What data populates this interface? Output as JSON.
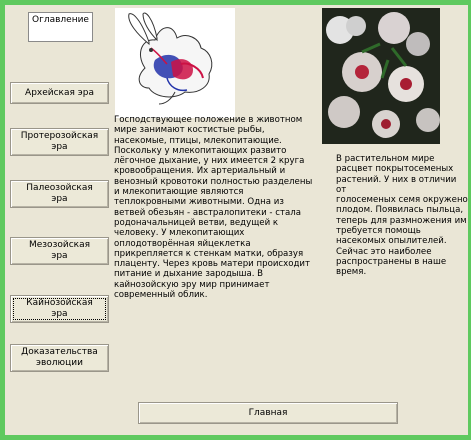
{
  "contents_label": "Оглавление",
  "nav": [
    {
      "label": "Архейская эра"
    },
    {
      "label": "Протерозойская\nэра"
    },
    {
      "label": "Палеозойская\nэра"
    },
    {
      "label": "Мезозойская\nэра"
    },
    {
      "label": "Кайнозойская\nэра"
    },
    {
      "label": "Доказательства\nэволюции"
    }
  ],
  "main_text": "Господствующее положение в животном\nмире  занимают костистые рыбы,\nнасекомые, птицы, млекопитающие.\nПоскольку у млекопитающих развито\nлёгочное дыхание, у них имеется 2 круга\nкровообращения. Их артериальный и\nвенозный кровотоки полностью разделены\nи млекопитающие являются\nтеплокровными животными.  Одна из\nветвей обезьян - австралопитеки - стала\nродоначальницей ветви, ведущей к\nчеловеку. У млекопитающих\nоплодотворённая яйцеклетка\nприкрепляется к стенкам матки, образуя\nплаценту. Через кровь матери происходит\nпитание и дыхание зародыша. В\nкайнозойскую эру  мир принимает\nсовременный облик.",
  "side_text": "В растительном мире\nрасцвет покрытосеменых\nрастений. У них в отличии от\nголосеменых семя окружено\nплодом. Появилась пыльца,\nтеперь для размножения им\nтребуется помощь\nнасекомых опылителей.\nСейчас это наиболее\nраспространены в наше\nвремя.",
  "home_label": "Главная",
  "colors": {
    "background": "#5fc95f",
    "panel": "#eae6d6"
  },
  "icons": [
    "rabbit-circulation-diagram",
    "flower-photo"
  ]
}
